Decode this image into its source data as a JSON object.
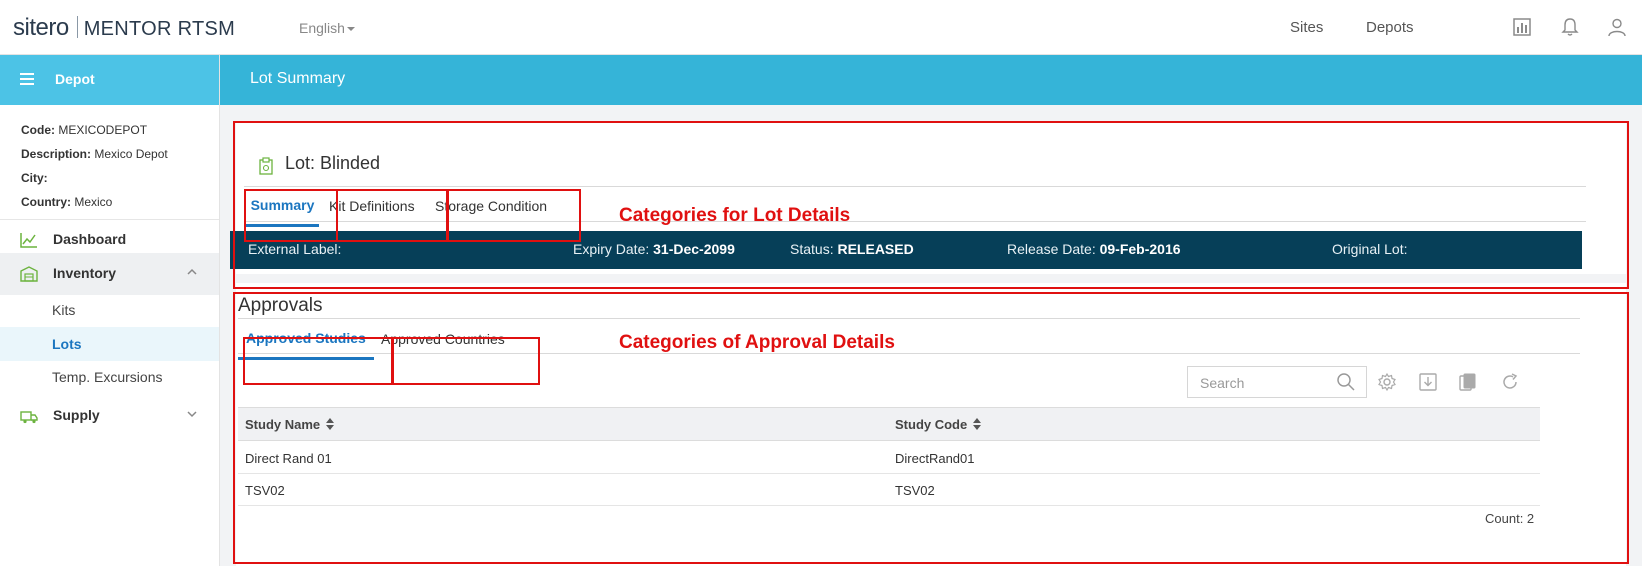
{
  "header": {
    "logo_brand": "sitero",
    "logo_product": "MENTOR RTSM",
    "language": "English",
    "nav": [
      "Sites",
      "Depots"
    ],
    "icons": [
      "reports-icon",
      "bell-icon",
      "user-icon"
    ]
  },
  "sidebar": {
    "title": "Depot",
    "info": {
      "code_label": "Code:",
      "code_value": "MEXICODEPOT",
      "description_label": "Description:",
      "description_value": "Mexico Depot",
      "city_label": "City:",
      "city_value": "",
      "country_label": "Country:",
      "country_value": "Mexico"
    },
    "items": [
      {
        "label": "Dashboard",
        "icon": "chart-line-icon"
      },
      {
        "label": "Inventory",
        "icon": "warehouse-icon",
        "expanded": true,
        "children": [
          "Kits",
          "Lots",
          "Temp. Excursions"
        ],
        "active_child": "Lots"
      },
      {
        "label": "Supply",
        "icon": "truck-icon",
        "expanded": false
      }
    ]
  },
  "page": {
    "title": "Lot Summary",
    "lot_title": "Lot: Blinded",
    "lot_tabs": [
      "Summary",
      "Kit Definitions",
      "Storage Condition"
    ],
    "active_lot_tab": "Summary",
    "info_strip": {
      "external_label": "External Label:",
      "expiry_label": "Expiry Date:",
      "expiry_value": "31-Dec-2099",
      "status_label": "Status:",
      "status_value": "RELEASED",
      "release_label": "Release Date:",
      "release_value": "09-Feb-2016",
      "original_label": "Original Lot:"
    },
    "approvals_title": "Approvals",
    "approval_tabs": [
      "Approved Studies",
      "Approved Countries"
    ],
    "active_approval_tab": "Approved Studies",
    "search_placeholder": "Search",
    "grid": {
      "columns": [
        "Study Name",
        "Study Code"
      ],
      "rows": [
        [
          "Direct Rand 01",
          "DirectRand01"
        ],
        [
          "TSV02",
          "TSV02"
        ]
      ],
      "count_text": "Count: 2"
    }
  },
  "annotations": {
    "lot_categories": "Categories for Lot Details",
    "approval_categories": "Categories of Approval Details",
    "color": "#e01010"
  },
  "colors": {
    "primary_blue": "#35b4d8",
    "sidebar_header": "#4cc3e6",
    "info_strip": "#063f58",
    "active_tab": "#1b76c0"
  }
}
